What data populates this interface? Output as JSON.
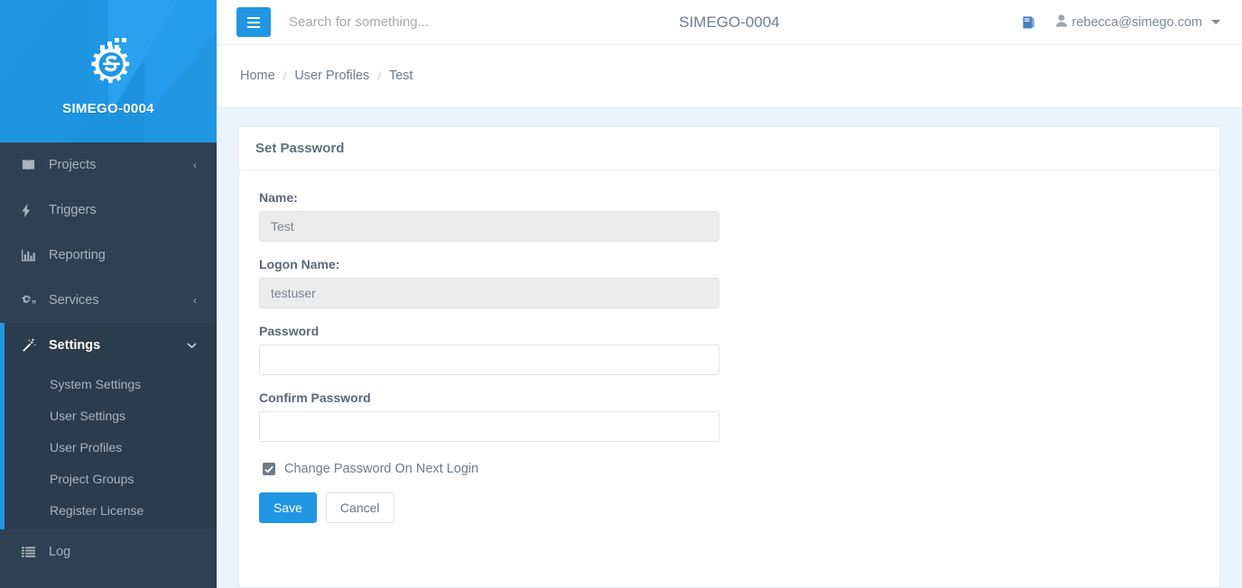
{
  "sidebar": {
    "logo": {
      "icon": "gear-s-logo",
      "text": "SIMEGO-0004"
    },
    "items": [
      {
        "label": "Projects",
        "icon": "book-icon",
        "chevron": "‹"
      },
      {
        "label": "Triggers",
        "icon": "bolt-icon",
        "chevron": ""
      },
      {
        "label": "Reporting",
        "icon": "bar-chart-icon",
        "chevron": ""
      },
      {
        "label": "Services",
        "icon": "gears-icon",
        "chevron": "‹"
      },
      {
        "label": "Settings",
        "icon": "magic-wand-icon",
        "chevron": "⌄",
        "active": true,
        "submenu": [
          {
            "label": "System Settings"
          },
          {
            "label": "User Settings"
          },
          {
            "label": "User Profiles"
          },
          {
            "label": "Project Groups"
          },
          {
            "label": "Register License"
          }
        ]
      },
      {
        "label": "Log",
        "icon": "list-icon",
        "chevron": ""
      }
    ]
  },
  "topbar": {
    "menu_toggle": "hamburger-icon",
    "search_placeholder": "Search for something...",
    "search_value": "",
    "title": "SIMEGO-0004",
    "docs_icon": "book-icon",
    "user_email": "rebecca@simego.com"
  },
  "breadcrumb": {
    "items": [
      "Home",
      "User Profiles",
      "Test"
    ],
    "separator": "/"
  },
  "panel": {
    "title": "Set Password",
    "fields": [
      {
        "label": "Name:",
        "value": "Test",
        "disabled": true
      },
      {
        "label": "Logon Name:",
        "value": "testuser",
        "disabled": true
      },
      {
        "label": "Password",
        "value": "",
        "disabled": false
      },
      {
        "label": "Confirm Password",
        "value": "",
        "disabled": false
      }
    ],
    "checkbox": {
      "label": "Change Password On Next Login",
      "checked": true
    },
    "buttons": {
      "save": "Save",
      "cancel": "Cancel"
    }
  },
  "colors": {
    "accent": "#2196e3",
    "sidebar_bg": "#2e4052",
    "sidebar_active_bg": "#2b3c4c",
    "content_bg": "#ebf3fc",
    "panel_bg": "#ffffff",
    "muted_text": "#6e7c89"
  }
}
